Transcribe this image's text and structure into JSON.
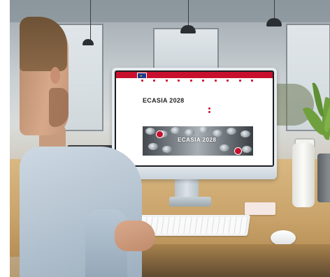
{
  "scene": {
    "description_type": "photo",
    "colors": {
      "brand_red": "#c8102e",
      "eu_blue": "#1f3a8a"
    }
  },
  "website": {
    "topbar_link": "",
    "nav_items": [
      "",
      "",
      "",
      "",
      "",
      "",
      "",
      "",
      "",
      ""
    ],
    "title": "ECASIA 2028",
    "subtitle": "",
    "info": [
      "",
      ""
    ],
    "banner_title": "ECASIA 2028"
  }
}
